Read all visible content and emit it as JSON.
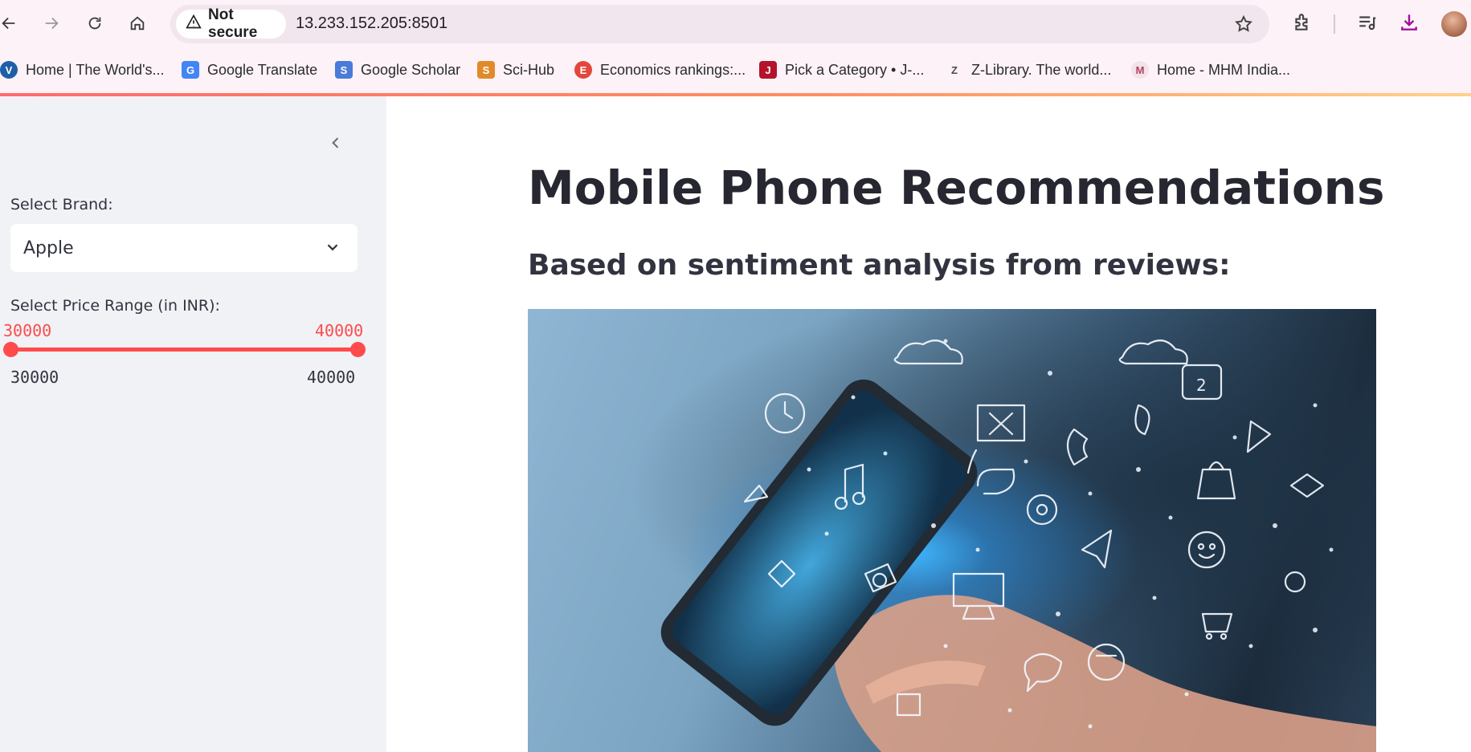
{
  "browser": {
    "security_label": "Not secure",
    "url": "13.233.152.205:8501",
    "bookmarks": [
      {
        "label": "Home | The World's...",
        "icon": "V"
      },
      {
        "label": "Google Translate",
        "icon": "G"
      },
      {
        "label": "Google Scholar",
        "icon": "S"
      },
      {
        "label": "Sci-Hub",
        "icon": "S"
      },
      {
        "label": "Economics rankings:...",
        "icon": "E"
      },
      {
        "label": "Pick a Category • J-...",
        "icon": "J"
      },
      {
        "label": "Z-Library. The world...",
        "icon": "Z"
      },
      {
        "label": "Home - MHM India...",
        "icon": "M"
      }
    ]
  },
  "sidebar": {
    "brand_label": "Select Brand:",
    "brand_value": "Apple",
    "price_label": "Select Price Range (in INR):",
    "price_low": "30000",
    "price_high": "40000",
    "min_label": "30000",
    "max_label": "40000",
    "accent_color": "#ff4b4b"
  },
  "main": {
    "title": "Mobile Phone Recommendations",
    "subtitle": "Based on sentiment analysis from reviews:"
  }
}
